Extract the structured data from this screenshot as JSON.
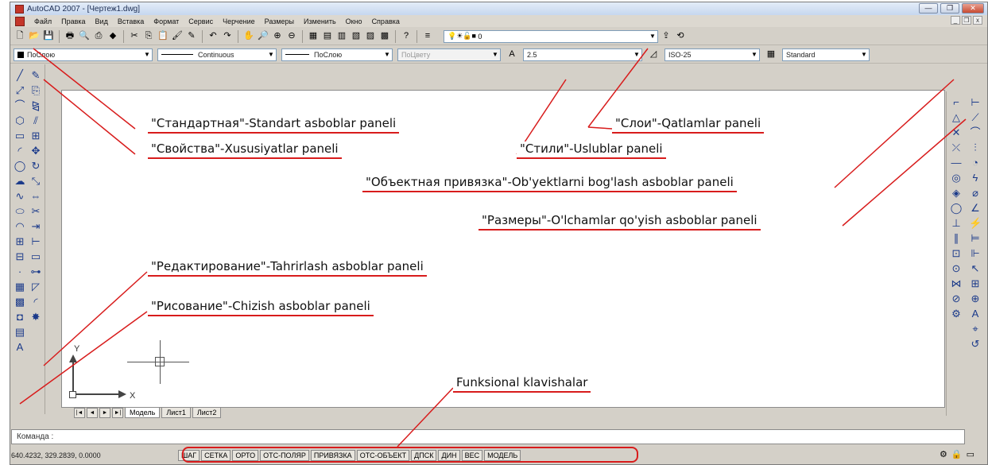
{
  "window": {
    "title": "AutoCAD 2007 - [Чертеж1.dwg]",
    "controls": [
      "—",
      "❐",
      "✕"
    ]
  },
  "menu": {
    "items": [
      "Файл",
      "Правка",
      "Вид",
      "Вставка",
      "Формат",
      "Сервис",
      "Черчение",
      "Размеры",
      "Изменить",
      "Окно",
      "Справка"
    ],
    "doc_controls": [
      "_",
      "❐",
      "x"
    ]
  },
  "toolbar_standard": {
    "layer_value": "0"
  },
  "toolbar_properties": {
    "color": "ПоСлою",
    "linetype": "Continuous",
    "lineweight": "ПоСлою",
    "plotstyle": "ПоЦвету",
    "text_style": "2.5",
    "dim_style": "ISO-25",
    "table_style": "Standard"
  },
  "left_toolbar": {
    "col1_icons": [
      "line-icon",
      "xline-icon",
      "polyline-icon",
      "polygon-icon",
      "rectangle-icon",
      "arc-icon",
      "circle-icon",
      "revcloud-icon",
      "spline-icon",
      "ellipse-icon",
      "ellipse-arc-icon",
      "insert-block-icon",
      "make-block-icon",
      "point-icon",
      "hatch-icon",
      "gradient-icon",
      "region-icon",
      "table-icon",
      "mtext-icon"
    ],
    "col2_icons": [
      "erase-icon",
      "copy-icon",
      "mirror-icon",
      "offset-icon",
      "array-icon",
      "move-icon",
      "rotate-icon",
      "scale-icon",
      "stretch-icon",
      "trim-icon",
      "extend-icon",
      "break-point-icon",
      "break-icon",
      "join-icon",
      "chamfer-icon",
      "fillet-icon",
      "explode-icon"
    ]
  },
  "right_toolbar": {
    "col1_icons": [
      "endpoint-snap-icon",
      "midpoint-snap-icon",
      "intersection-snap-icon",
      "apparent-snap-icon",
      "extension-snap-icon",
      "center-snap-icon",
      "quadrant-snap-icon",
      "tangent-snap-icon",
      "perpendicular-snap-icon",
      "parallel-snap-icon",
      "insert-snap-icon",
      "node-snap-icon",
      "nearest-snap-icon",
      "none-snap-icon",
      "osnap-settings-icon"
    ],
    "col2_icons": [
      "linear-dim-icon",
      "aligned-dim-icon",
      "arc-length-dim-icon",
      "ordinate-dim-icon",
      "radius-dim-icon",
      "jogged-dim-icon",
      "diameter-dim-icon",
      "angular-dim-icon",
      "quick-dim-icon",
      "baseline-dim-icon",
      "continue-dim-icon",
      "qleader-icon",
      "tolerance-icon",
      "center-mark-icon",
      "dimedit-icon",
      "dimtedit-icon",
      "dim-update-icon"
    ]
  },
  "drawing": {
    "ucs_y": "Y",
    "ucs_x": "X"
  },
  "tabs": {
    "nav": [
      "|◄",
      "◄",
      "►",
      "►|"
    ],
    "items": [
      "Модель",
      "Лист1",
      "Лист2"
    ]
  },
  "command": {
    "prompt": "Команда :"
  },
  "status": {
    "coords": "640.4232, 329.2839, 0.0000",
    "buttons": [
      "ШАГ",
      "СЕТКА",
      "ОРТО",
      "ОТС-ПОЛЯР",
      "ПРИВЯЗКА",
      "ОТС-ОБЪЕКТ",
      "ДПСК",
      "ДИН",
      "ВЕС",
      "МОДЕЛЬ"
    ]
  },
  "annotations": {
    "standard": "\"Стандартная\"-Standart asboblar paneli",
    "layers": "\"Слои\"-Qatlamlar paneli",
    "properties": "\"Свойства\"-Xususiyatlar paneli",
    "styles": "\"Стили\"-Uslublar paneli",
    "osnap": "\"Объектная привязка\"-Ob'yektlarni bog'lash asboblar paneli",
    "dimensions": "\"Размеры\"-O'lchamlar qo'yish asboblar paneli",
    "modify": "\"Редактирование\"-Tahrirlash asboblar paneli",
    "draw": "\"Рисование\"-Chizish asboblar paneli",
    "fkeys": "Funksional klavishalar"
  },
  "colors": {
    "accent_red": "#d81c1c",
    "ui_face": "#d4d0c8",
    "icon_blue": "#1b3a8a"
  }
}
